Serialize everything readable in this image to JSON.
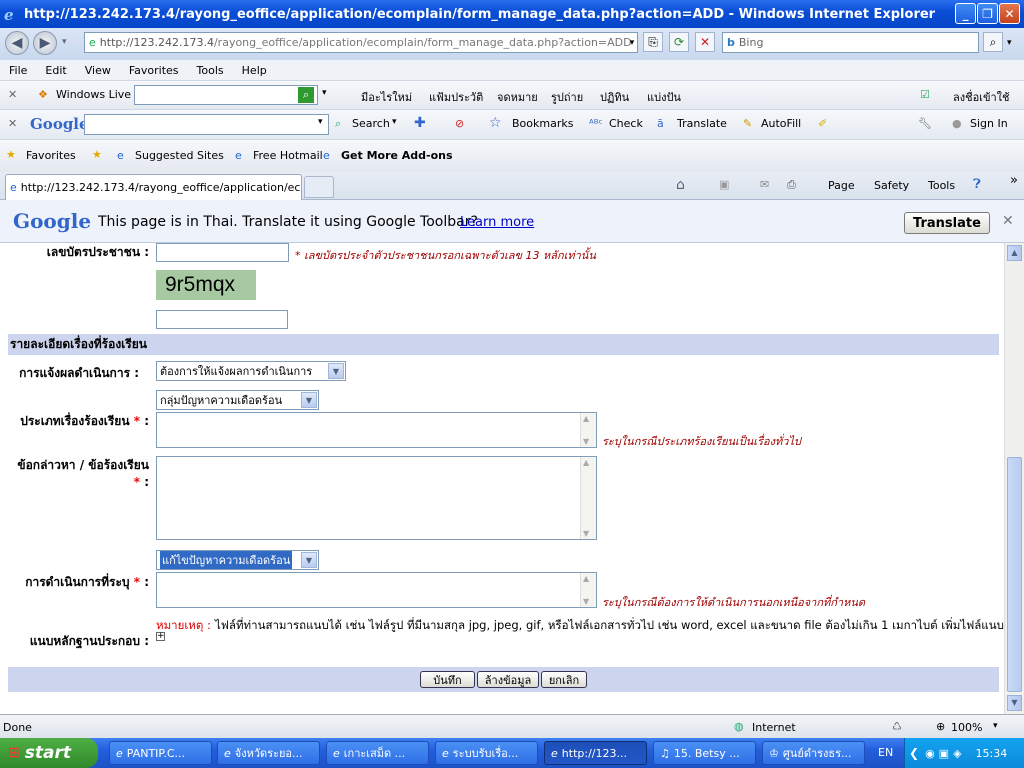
{
  "window": {
    "title": "http://123.242.173.4/rayong_eoffice/application/ecomplain/form_manage_data.php?action=ADD - Windows Internet Explorer"
  },
  "address": {
    "url_host": "http://123.242.173.4",
    "url_path": "/rayong_eoffice/application/ecomplain/form_manage_data.php?action=ADD",
    "search_placeholder": "Bing"
  },
  "menu": [
    "File",
    "Edit",
    "View",
    "Favorites",
    "Tools",
    "Help"
  ],
  "live_toolbar": {
    "brand": "Windows Live",
    "links": [
      "มีอะไรใหม่",
      "แฟ้มประวัติ",
      "จดหมาย",
      "รูปถ่าย",
      "ปฏิทิน",
      "แบ่งปัน"
    ],
    "signin": "ลงชื่อเข้าใช้"
  },
  "google_toolbar": {
    "brand": "Google",
    "search": "Search",
    "bookmarks": "Bookmarks",
    "check": "Check",
    "translate": "Translate",
    "autofill": "AutoFill",
    "signin": "Sign In"
  },
  "favorites_bar": {
    "favorites": "Favorites",
    "items": [
      "Suggested Sites",
      "Free Hotmail",
      "Get More Add-ons"
    ]
  },
  "tab": {
    "label": "http://123.242.173.4/rayong_eoffice/application/eco..."
  },
  "commandbar": {
    "page": "Page",
    "safety": "Safety",
    "tools": "Tools"
  },
  "translate_bar": {
    "brand": "Google",
    "message": "This page is in Thai.  Translate it using Google Toolbar?",
    "learn_more": "Learn more",
    "button": "Translate"
  },
  "form": {
    "id_label": "เลขบัตรประชาชน :",
    "id_hint": "* เลขบัตรประจำตัวประชาชนกรอกเฉพาะตัวเลข 13 หลักเท่านั้น",
    "captcha": "9r5mqx",
    "section_title": "รายละเอียดเรื่องที่ร้องเรียน",
    "notify_label": "การแจ้งผลดำเนินการ :",
    "notify_value": "ต้องการให้แจ้งผลการดำเนินการ",
    "category_value": "กลุ่มปัญหาความเดือดร้อน",
    "type_label": "ประเภทเรื่องร้องเรียน",
    "type_hint": "ระบุในกรณีประเภทร้องเรียนเป็นเรื่องทั่วไป",
    "detail_label": "ข้อกล่าวหา / ข้อร้องเรียน",
    "action_value": "แก้ไขปัญหาความเดือดร้อน",
    "action_label": "การดำเนินการที่ระบุ",
    "action_hint": "ระบุในกรณีต้องการให้ดำเนินการนอกเหนือจากที่กำหนด",
    "attach_label": "แนบหลักฐานประกอบ :",
    "note_label": "หมายเหตุ :",
    "note_text": "ไฟล์ที่ท่านสามารถแนบได้ เช่น ไฟล์รูป ที่มีนามสกุล jpg, jpeg, gif, หรือไฟล์เอกสารทั่วไป เช่น word, excel และขนาด file ต้องไม่เกิน 1 เมกาไบต์ เพิ่มไฟล์แนบ",
    "required_mark": "*",
    "buttons": {
      "save": "บันทึก",
      "clear": "ล้างข้อมูล",
      "cancel": "ยกเลิก"
    }
  },
  "status": {
    "left": "Done",
    "zone": "Internet",
    "zoom": "100%"
  },
  "taskbar": {
    "start": "start",
    "tasks": [
      "PANTIP.C...",
      "จังหวัดระยอ...",
      "เกาะเสม็ด ...",
      "ระบบรับเรื่อ...",
      "http://123...",
      "15. Betsy ...",
      "ศูนย์ดำรงธร..."
    ],
    "lang": "EN",
    "clock": "15:34"
  }
}
